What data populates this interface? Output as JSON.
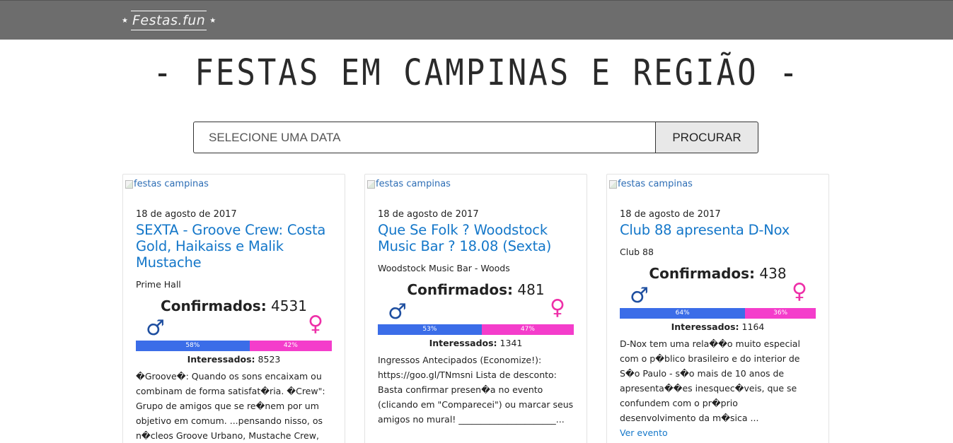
{
  "header": {
    "logo_text": "Festas.fun",
    "logo_star": "★"
  },
  "page_title": "- FESTAS EM CAMPINAS E REGIÃO -",
  "search": {
    "placeholder": "SELECIONE UMA DATA",
    "button_label": "PROCURAR"
  },
  "colors": {
    "topbar": "#6d6d6d",
    "link": "#1477c9",
    "male_bar": "#3b6de8",
    "female_bar": "#f43dcb"
  },
  "icons": {
    "male": "♂",
    "female": "♀"
  },
  "cards": [
    {
      "image_alt": "festas campinas",
      "date": "18 de agosto de 2017",
      "title": "SEXTA - Groove Crew: Costa Gold, Haikaiss e Malik Mustache",
      "venue": "Prime Hall",
      "confirmed_label": "Confirmados:",
      "confirmed": "4531",
      "male_pct": 58,
      "female_pct": 42,
      "male_label": "58%",
      "female_label": "42%",
      "interested_label": "Interessados:",
      "interested": "8523",
      "description": "�Groove�: Quando os sons encaixam ou combinam de forma satisfat�ria. �Crew\": Grupo de amigos que se re�nem por um objetivo em comum. ...pensando nisso, os n�cleos Groove Urbano, Mustache Crew,",
      "more_link": ""
    },
    {
      "image_alt": "festas campinas",
      "date": "18 de agosto de 2017",
      "title": "Que Se Folk ? Woodstock Music Bar ? 18.08 (Sexta)",
      "venue": "Woodstock Music Bar - Woods",
      "confirmed_label": "Confirmados:",
      "confirmed": "481",
      "male_pct": 53,
      "female_pct": 47,
      "male_label": "53%",
      "female_label": "47%",
      "interested_label": "Interessados:",
      "interested": "1341",
      "description": "Ingressos Antecipados (Economize!): https://goo.gl/TNmsni Lista de desconto: Basta confirmar presen�a no evento (clicando em \"Comparecei\") ou marcar seus amigos no mural! ______________________...",
      "more_link": ""
    },
    {
      "image_alt": "festas campinas",
      "date": "18 de agosto de 2017",
      "title": "Club 88 apresenta D-Nox",
      "venue": "Club 88",
      "confirmed_label": "Confirmados:",
      "confirmed": "438",
      "male_pct": 64,
      "female_pct": 36,
      "male_label": "64%",
      "female_label": "36%",
      "interested_label": "Interessados:",
      "interested": "1164",
      "description": "D-Nox tem uma rela��o muito especial com o p�blico brasileiro e do interior de S�o Paulo - s�o mais de 10 anos de apresenta��es inesquec�veis, que se confundem com o pr�prio desenvolvimento da m�sica ...",
      "more_link": "Ver evento"
    }
  ]
}
